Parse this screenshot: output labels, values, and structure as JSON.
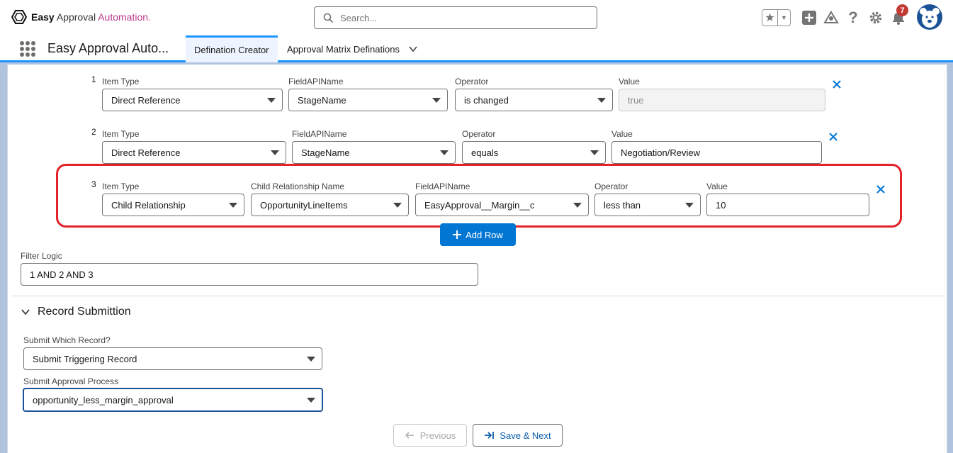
{
  "header": {
    "logo_bold": "Easy",
    "logo_mid": "Approval",
    "logo_accent": "Automation.",
    "search_placeholder": "Search...",
    "notification_count": "7",
    "colors": {
      "brand_blue": "#1b96ff",
      "primary_button": "#0176d3",
      "highlight_red": "#e3222a",
      "badge_red": "#c23934"
    }
  },
  "nav": {
    "app_name": "Easy Approval Auto...",
    "tabs": [
      {
        "label": "Defination Creator",
        "active": true
      },
      {
        "label": "Approval Matrix Definations",
        "active": false
      }
    ]
  },
  "criteria": {
    "rows": [
      {
        "number": "1",
        "fields": [
          {
            "label": "Item Type",
            "value": "Direct Reference"
          },
          {
            "label": "FieldAPIName",
            "value": "StageName"
          },
          {
            "label": "Operator",
            "value": "is changed"
          },
          {
            "label": "Value",
            "value": "true"
          }
        ]
      },
      {
        "number": "2",
        "fields": [
          {
            "label": "Item Type",
            "value": "Direct Reference"
          },
          {
            "label": "FieldAPIName",
            "value": "StageName"
          },
          {
            "label": "Operator",
            "value": "equals"
          },
          {
            "label": "Value",
            "value": "Negotiation/Review"
          }
        ]
      },
      {
        "number": "3",
        "fields": [
          {
            "label": "Item Type",
            "value": "Child Relationship"
          },
          {
            "label": "Child Relationship Name",
            "value": "OpportunityLineItems"
          },
          {
            "label": "FieldAPIName",
            "value": "EasyApproval__Margin__c"
          },
          {
            "label": "Operator",
            "value": "less than"
          },
          {
            "label": "Value",
            "value": "10"
          }
        ]
      }
    ],
    "add_row_label": "Add Row",
    "filter_logic_label": "Filter Logic",
    "filter_logic_value": "1 AND 2 AND 3"
  },
  "record_submission": {
    "section_title": "Record Submittion",
    "which_record_label": "Submit Which Record?",
    "which_record_value": "Submit Triggering Record",
    "approval_process_label": "Submit Approval Process",
    "approval_process_value": "opportunity_less_margin_approval"
  },
  "footer": {
    "previous_label": "Previous",
    "save_next_label": "Save & Next"
  }
}
